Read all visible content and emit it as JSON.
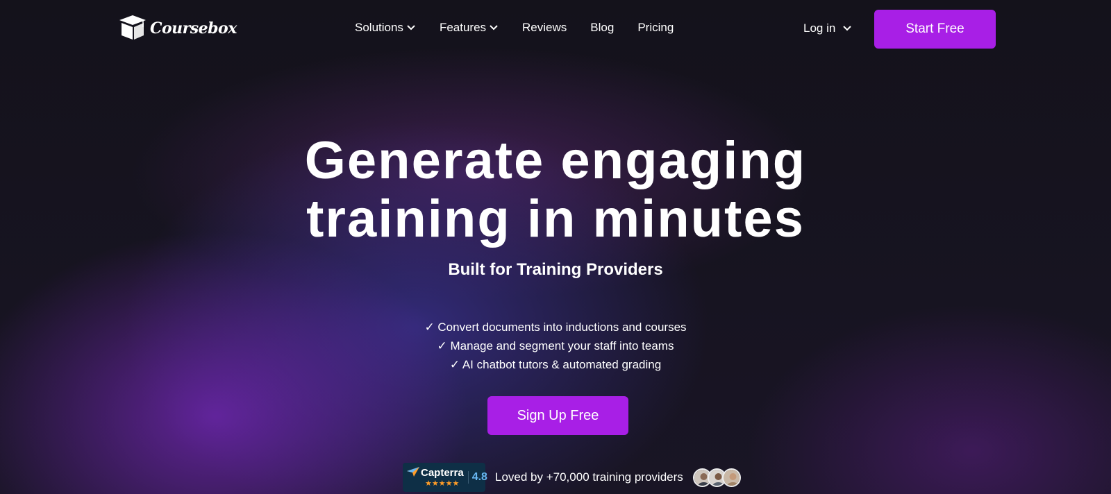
{
  "header": {
    "logo_text": "Coursebox",
    "nav": [
      {
        "label": "Solutions",
        "dropdown": true
      },
      {
        "label": "Features",
        "dropdown": true
      },
      {
        "label": "Reviews",
        "dropdown": false
      },
      {
        "label": "Blog",
        "dropdown": false
      },
      {
        "label": "Pricing",
        "dropdown": false
      }
    ],
    "login_label": "Log in",
    "start_label": "Start Free"
  },
  "hero": {
    "title_line1": "Generate engaging",
    "title_line2": "training in minutes",
    "subtitle": "Built for Training Providers",
    "checks": [
      "✓ Convert documents into inductions and courses",
      "✓ Manage and segment your staff into teams",
      "✓ AI chatbot tutors & automated grading"
    ],
    "cta_label": "Sign Up Free"
  },
  "social_proof": {
    "capterra_name": "Capterra",
    "capterra_stars": "★★★★★",
    "capterra_score": "4.8",
    "loved_text": "Loved by +70,000 training providers"
  },
  "colors": {
    "accent": "#a81fe6",
    "background": "#15121d",
    "capterra_bg": "#0e2f46",
    "star": "#ff9d28"
  }
}
